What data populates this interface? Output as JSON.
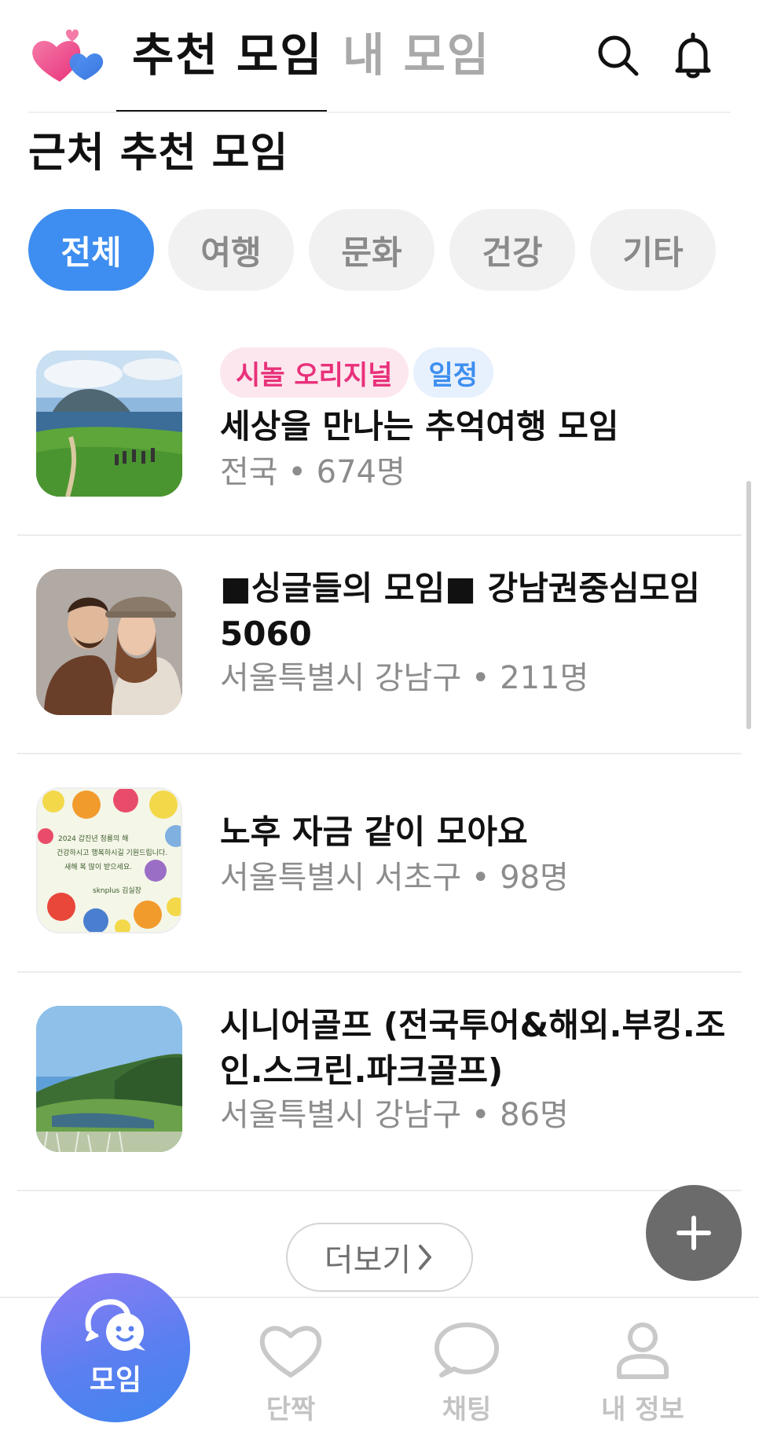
{
  "header": {
    "tabs": [
      {
        "label": "추천 모임",
        "active": true
      },
      {
        "label": "내 모임",
        "active": false
      }
    ],
    "icons": [
      "search-icon",
      "bell-icon"
    ]
  },
  "section": {
    "title": "근처 추천 모임"
  },
  "categories": [
    {
      "label": "전체",
      "active": true
    },
    {
      "label": "여행",
      "active": false
    },
    {
      "label": "문화",
      "active": false
    },
    {
      "label": "건강",
      "active": false
    },
    {
      "label": "기타",
      "active": false
    }
  ],
  "groups": [
    {
      "badges": [
        "시놀 오리지널",
        "일정"
      ],
      "title": "세상을 만나는 추억여행 모임",
      "meta": "전국 • 674명"
    },
    {
      "badges": [],
      "title": "■싱글들의 모임■ 강남권중심모임 5060",
      "meta": "서울특별시 강남구 • 211명"
    },
    {
      "badges": [],
      "title": "노후 자금 같이 모아요",
      "meta": "서울특별시 서초구 • 98명"
    },
    {
      "badges": [],
      "title": "시니어골프 (전국투어&해외.부킹.조인.스크린.파크골프)",
      "meta": "서울특별시 강남구 • 86명"
    }
  ],
  "thumb_caption": {
    "line1": "2024 갑진년  청룡의 해",
    "line2": "건강하시고 행복하시길 기원드립니다.",
    "line3": "새해 복 많이 받으세요.",
    "line4": "sknplus  김실장"
  },
  "more_button": {
    "label": "더보기"
  },
  "fab": {
    "icon": "plus-icon"
  },
  "bottom_nav": {
    "items": [
      {
        "label": "모임",
        "icon": "chat-smile-icon",
        "active": true
      },
      {
        "label": "단짝",
        "icon": "heart-icon",
        "active": false
      },
      {
        "label": "채팅",
        "icon": "chat-bubble-icon",
        "active": false
      },
      {
        "label": "내 정보",
        "icon": "person-icon",
        "active": false
      }
    ]
  },
  "colors": {
    "accent": "#3d8ef0",
    "badge_pink": "#e8317a",
    "fab": "#6b6b6b",
    "muted": "#8c8c8c"
  }
}
